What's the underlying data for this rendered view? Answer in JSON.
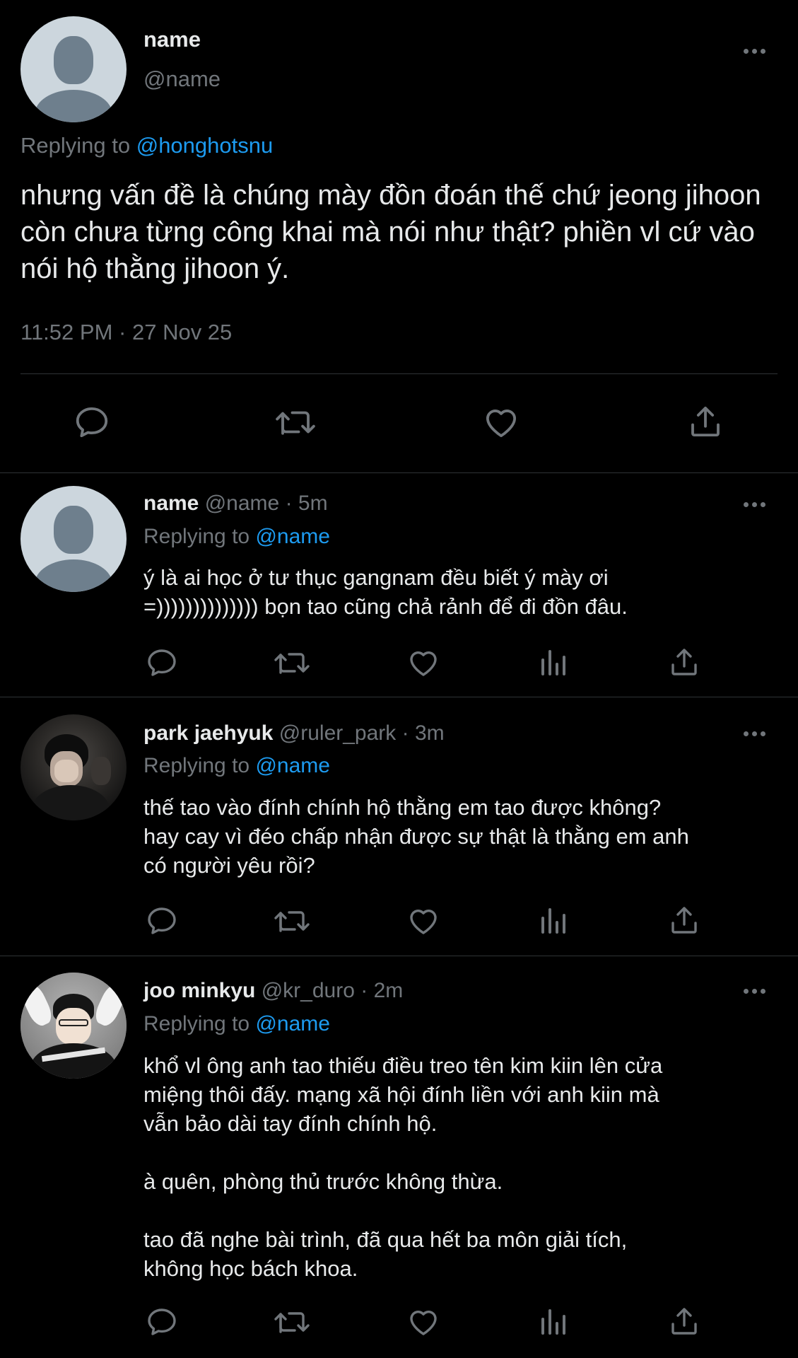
{
  "main_tweet": {
    "display_name": "name",
    "handle": "@name",
    "replying_prefix": "Replying to",
    "replying_handle": "@honghotsnu",
    "text": "nhưng vấn đề là chúng mày đồn đoán thế chứ jeong jihoon còn chưa từng công khai mà nói như thật? phiền vl cứ vào nói hộ thằng jihoon ý.",
    "time": "11:52 PM",
    "separator": "·",
    "date": "27 Nov 25"
  },
  "replies": [
    {
      "display_name": "name",
      "handle": "@name",
      "separator": "·",
      "time_ago": "5m",
      "replying_prefix": "Replying to",
      "replying_handle": "@name",
      "text": "ý là ai học ở tư thục gangnam đều biết ý mày ơi\n=)))))))))))))) bọn tao cũng chả rảnh để đi đồn đâu."
    },
    {
      "display_name": "park jaehyuk",
      "handle": "@ruler_park",
      "separator": "·",
      "time_ago": "3m",
      "replying_prefix": "Replying to",
      "replying_handle": "@name",
      "text": "thế tao vào đính chính hộ thằng em tao được không?\nhay cay vì đéo chấp nhận được sự thật là thằng em anh\ncó người yêu rồi?"
    },
    {
      "display_name": "joo minkyu",
      "handle": "@kr_duro",
      "separator": "·",
      "time_ago": "2m",
      "replying_prefix": "Replying to",
      "replying_handle": "@name",
      "text": "khổ vl ông anh tao thiếu điều treo tên kim kiin lên cửa\nmiệng thôi đấy. mạng xã hội đính liền với anh kiin mà\nvẫn bảo dài tay đính chính hộ.\n\nà quên, phòng thủ trước không thừa.\n\ntao đã nghe bài trình, đã qua hết ba môn giải tích,\nkhông học bách khoa."
    }
  ],
  "icons": {
    "reply": "reply-icon",
    "retweet": "retweet-icon",
    "like": "heart-icon",
    "views": "views-icon",
    "share": "share-icon",
    "more": "more-icon"
  },
  "colors": {
    "background": "#000000",
    "text": "#e7e9ea",
    "secondary": "#71767b",
    "accent": "#1d9bf0",
    "divider": "#2f3336"
  }
}
